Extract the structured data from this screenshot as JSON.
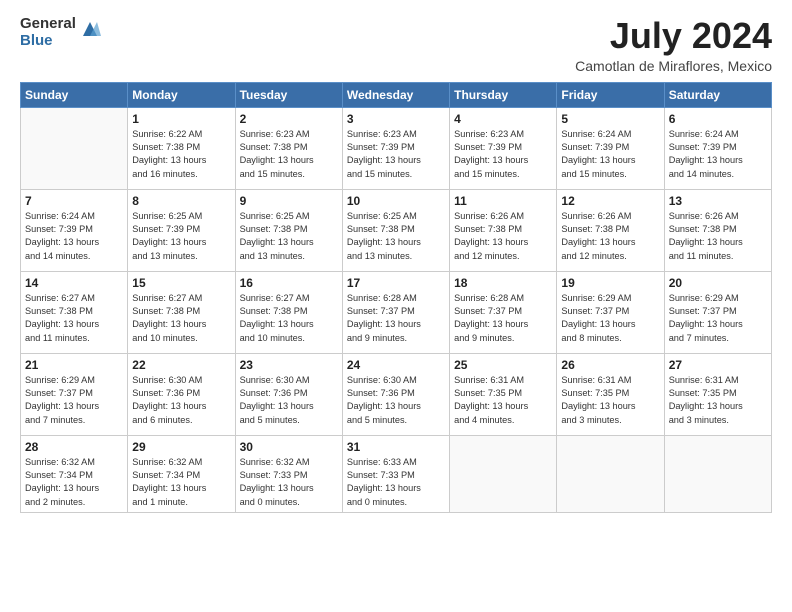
{
  "logo": {
    "general": "General",
    "blue": "Blue"
  },
  "title": "July 2024",
  "subtitle": "Camotlan de Miraflores, Mexico",
  "days_header": [
    "Sunday",
    "Monday",
    "Tuesday",
    "Wednesday",
    "Thursday",
    "Friday",
    "Saturday"
  ],
  "weeks": [
    [
      {
        "day": "",
        "info": ""
      },
      {
        "day": "1",
        "info": "Sunrise: 6:22 AM\nSunset: 7:38 PM\nDaylight: 13 hours\nand 16 minutes."
      },
      {
        "day": "2",
        "info": "Sunrise: 6:23 AM\nSunset: 7:38 PM\nDaylight: 13 hours\nand 15 minutes."
      },
      {
        "day": "3",
        "info": "Sunrise: 6:23 AM\nSunset: 7:39 PM\nDaylight: 13 hours\nand 15 minutes."
      },
      {
        "day": "4",
        "info": "Sunrise: 6:23 AM\nSunset: 7:39 PM\nDaylight: 13 hours\nand 15 minutes."
      },
      {
        "day": "5",
        "info": "Sunrise: 6:24 AM\nSunset: 7:39 PM\nDaylight: 13 hours\nand 15 minutes."
      },
      {
        "day": "6",
        "info": "Sunrise: 6:24 AM\nSunset: 7:39 PM\nDaylight: 13 hours\nand 14 minutes."
      }
    ],
    [
      {
        "day": "7",
        "info": "Sunrise: 6:24 AM\nSunset: 7:39 PM\nDaylight: 13 hours\nand 14 minutes."
      },
      {
        "day": "8",
        "info": "Sunrise: 6:25 AM\nSunset: 7:39 PM\nDaylight: 13 hours\nand 13 minutes."
      },
      {
        "day": "9",
        "info": "Sunrise: 6:25 AM\nSunset: 7:38 PM\nDaylight: 13 hours\nand 13 minutes."
      },
      {
        "day": "10",
        "info": "Sunrise: 6:25 AM\nSunset: 7:38 PM\nDaylight: 13 hours\nand 13 minutes."
      },
      {
        "day": "11",
        "info": "Sunrise: 6:26 AM\nSunset: 7:38 PM\nDaylight: 13 hours\nand 12 minutes."
      },
      {
        "day": "12",
        "info": "Sunrise: 6:26 AM\nSunset: 7:38 PM\nDaylight: 13 hours\nand 12 minutes."
      },
      {
        "day": "13",
        "info": "Sunrise: 6:26 AM\nSunset: 7:38 PM\nDaylight: 13 hours\nand 11 minutes."
      }
    ],
    [
      {
        "day": "14",
        "info": "Sunrise: 6:27 AM\nSunset: 7:38 PM\nDaylight: 13 hours\nand 11 minutes."
      },
      {
        "day": "15",
        "info": "Sunrise: 6:27 AM\nSunset: 7:38 PM\nDaylight: 13 hours\nand 10 minutes."
      },
      {
        "day": "16",
        "info": "Sunrise: 6:27 AM\nSunset: 7:38 PM\nDaylight: 13 hours\nand 10 minutes."
      },
      {
        "day": "17",
        "info": "Sunrise: 6:28 AM\nSunset: 7:37 PM\nDaylight: 13 hours\nand 9 minutes."
      },
      {
        "day": "18",
        "info": "Sunrise: 6:28 AM\nSunset: 7:37 PM\nDaylight: 13 hours\nand 9 minutes."
      },
      {
        "day": "19",
        "info": "Sunrise: 6:29 AM\nSunset: 7:37 PM\nDaylight: 13 hours\nand 8 minutes."
      },
      {
        "day": "20",
        "info": "Sunrise: 6:29 AM\nSunset: 7:37 PM\nDaylight: 13 hours\nand 7 minutes."
      }
    ],
    [
      {
        "day": "21",
        "info": "Sunrise: 6:29 AM\nSunset: 7:37 PM\nDaylight: 13 hours\nand 7 minutes."
      },
      {
        "day": "22",
        "info": "Sunrise: 6:30 AM\nSunset: 7:36 PM\nDaylight: 13 hours\nand 6 minutes."
      },
      {
        "day": "23",
        "info": "Sunrise: 6:30 AM\nSunset: 7:36 PM\nDaylight: 13 hours\nand 5 minutes."
      },
      {
        "day": "24",
        "info": "Sunrise: 6:30 AM\nSunset: 7:36 PM\nDaylight: 13 hours\nand 5 minutes."
      },
      {
        "day": "25",
        "info": "Sunrise: 6:31 AM\nSunset: 7:35 PM\nDaylight: 13 hours\nand 4 minutes."
      },
      {
        "day": "26",
        "info": "Sunrise: 6:31 AM\nSunset: 7:35 PM\nDaylight: 13 hours\nand 3 minutes."
      },
      {
        "day": "27",
        "info": "Sunrise: 6:31 AM\nSunset: 7:35 PM\nDaylight: 13 hours\nand 3 minutes."
      }
    ],
    [
      {
        "day": "28",
        "info": "Sunrise: 6:32 AM\nSunset: 7:34 PM\nDaylight: 13 hours\nand 2 minutes."
      },
      {
        "day": "29",
        "info": "Sunrise: 6:32 AM\nSunset: 7:34 PM\nDaylight: 13 hours\nand 1 minute."
      },
      {
        "day": "30",
        "info": "Sunrise: 6:32 AM\nSunset: 7:33 PM\nDaylight: 13 hours\nand 0 minutes."
      },
      {
        "day": "31",
        "info": "Sunrise: 6:33 AM\nSunset: 7:33 PM\nDaylight: 13 hours\nand 0 minutes."
      },
      {
        "day": "",
        "info": ""
      },
      {
        "day": "",
        "info": ""
      },
      {
        "day": "",
        "info": ""
      }
    ]
  ]
}
